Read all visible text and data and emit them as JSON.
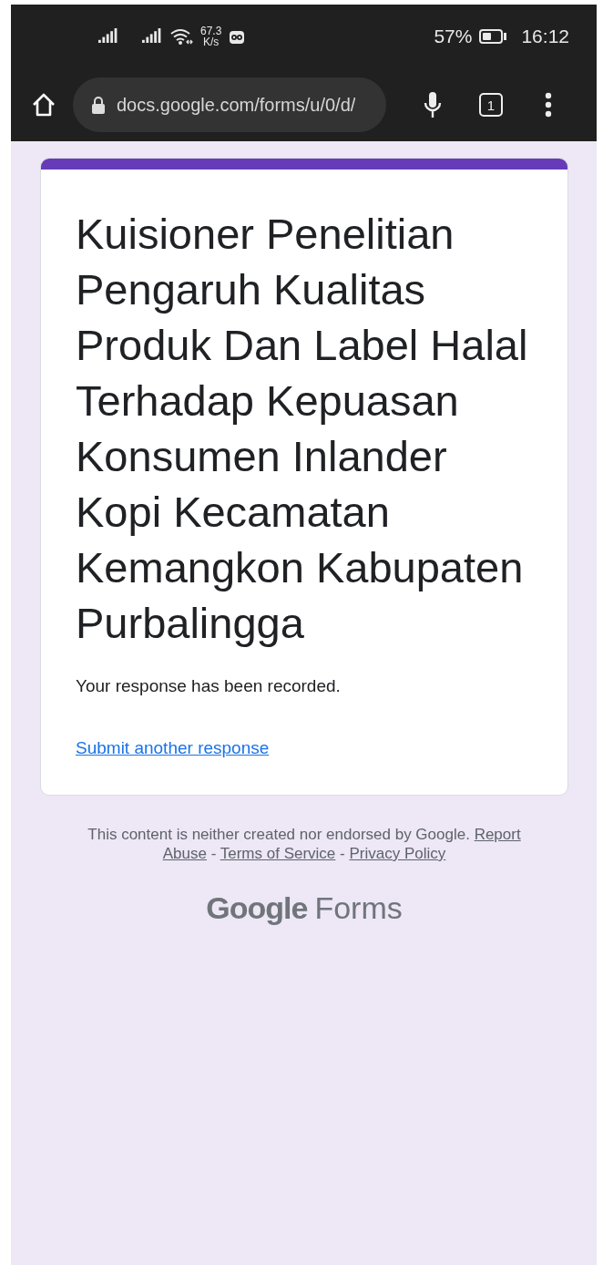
{
  "status_bar": {
    "speed_value": "67.3",
    "speed_unit": "K/s",
    "battery_percent": "57%",
    "time": "16:12"
  },
  "browser": {
    "url": "docs.google.com/forms/u/0/d/",
    "tab_count": "1"
  },
  "form": {
    "title": "Kuisioner Penelitian Pengaruh Kualitas Produk Dan Label Halal Terhadap Kepuasan Konsumen Inlander Kopi Kecamatan Kemangkon Kabupaten Purbalingga",
    "message": "Your response has been recorded.",
    "link": "Submit another response"
  },
  "footer": {
    "disclaimer": "This content is neither created nor endorsed by Google.",
    "links": [
      "Report Abuse",
      "Terms of Service",
      "Privacy Policy"
    ],
    "separator": "-",
    "logo_brand": "Google",
    "logo_product": "Forms"
  }
}
